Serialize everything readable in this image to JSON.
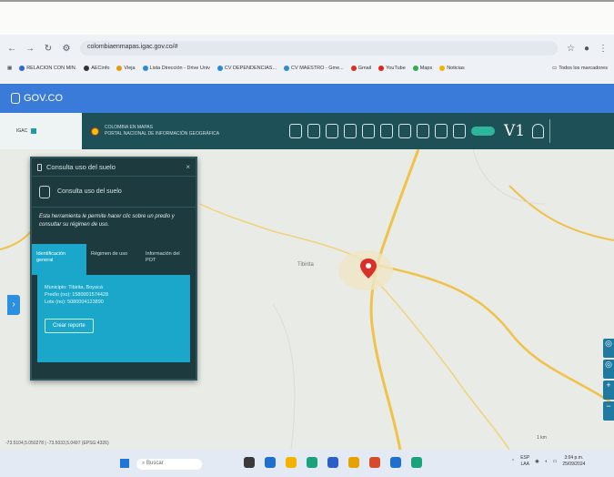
{
  "browser": {
    "url": "colombiaenmapas.igac.gov.co/#",
    "bookmarks": [
      "RELACION CON MIN.",
      "AECinfo",
      "Vieja",
      "Lista Dirección - Drive Univ",
      "CV DEPENDENCIAS...",
      "CV MAESTRO - Gme...",
      "Gmail",
      "YouTube",
      "Maps",
      "Noticias"
    ],
    "bookmark_right": "Todos los marcadores"
  },
  "gov": {
    "label": "GOV.CO"
  },
  "app": {
    "brand_line1": "COLOMBIA EN MAPAS",
    "brand_line2": "PORTAL NACIONAL DE INFORMACIÓN GEOGRÁFICA",
    "logo_text": "IGAC",
    "version": "V1"
  },
  "panel": {
    "title": "Consulta uso del suelo",
    "close": "×",
    "subtitle": "Consulta uso del suelo",
    "description": "Esta herramienta le permite hacer clic sobre un predio y consultar su régimen de uso.",
    "tabs": [
      "Identificación general",
      "Régimen de uso",
      "Información del POT"
    ],
    "info": {
      "municipio": "Municipio: Tibirita, Boyacá",
      "predio": "Predio (no): 1580001574428",
      "lote": "Lote (no): 5080004123890"
    },
    "button": "Crear reporte"
  },
  "map": {
    "place_label": "Tibirita",
    "coords": "-73.5104,5.050278 | -73.5033,5.0497 (EPSG:4326)",
    "scale": "1 km",
    "side_handle": "›",
    "zoom": [
      "◎",
      "◎",
      "+",
      "−"
    ]
  },
  "taskbar": {
    "search_placeholder": "Buscar",
    "lang": "ESP",
    "layout": "LAA",
    "time": "3:04 p.m.",
    "date": "25/09/2024"
  }
}
